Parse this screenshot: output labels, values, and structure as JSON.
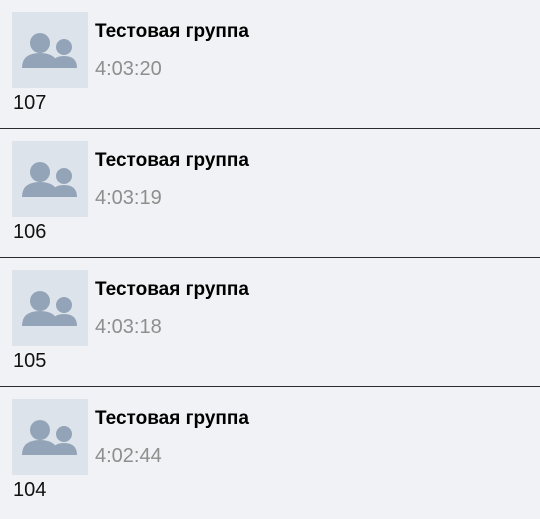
{
  "colors": {
    "background": "#f0f2f5",
    "avatar_background": "#dde3ea",
    "avatar_figure": "#93a4b8",
    "time_text": "#8e8e8e",
    "divider": "#2b2b2b"
  },
  "feed": {
    "posts": [
      {
        "avatar_icon": "group-silhouette-icon",
        "group_name": "Тестовая группа",
        "time": "4:03:20",
        "text": "107"
      },
      {
        "avatar_icon": "group-silhouette-icon",
        "group_name": "Тестовая группа",
        "time": "4:03:19",
        "text": "106"
      },
      {
        "avatar_icon": "group-silhouette-icon",
        "group_name": "Тестовая группа",
        "time": "4:03:18",
        "text": "105"
      },
      {
        "avatar_icon": "group-silhouette-icon",
        "group_name": "Тестовая группа",
        "time": "4:02:44",
        "text": "104"
      }
    ]
  }
}
